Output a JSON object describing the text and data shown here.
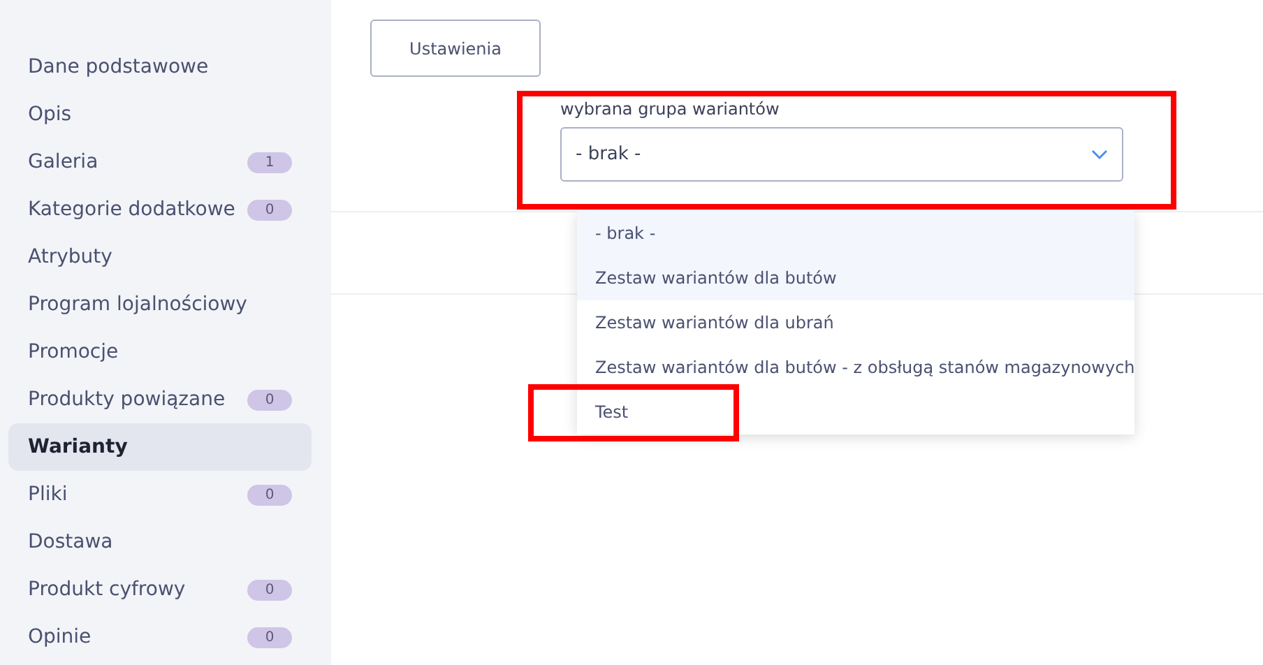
{
  "sidebar": {
    "items": [
      {
        "label": "Dane podstawowe",
        "selected": false
      },
      {
        "label": "Opis",
        "selected": false
      },
      {
        "label": "Galeria",
        "count": "1",
        "selected": false
      },
      {
        "label": "Kategorie dodatkowe",
        "count": "0",
        "selected": false
      },
      {
        "label": "Atrybuty",
        "selected": false
      },
      {
        "label": "Program lojalnościowy",
        "selected": false
      },
      {
        "label": "Promocje",
        "selected": false
      },
      {
        "label": "Produkty powiązane",
        "count": "0",
        "selected": false
      },
      {
        "label": "Warianty",
        "selected": true
      },
      {
        "label": "Pliki",
        "count": "0",
        "selected": false
      },
      {
        "label": "Dostawa",
        "selected": false
      },
      {
        "label": "Produkt cyfrowy",
        "count": "0",
        "selected": false
      },
      {
        "label": "Opinie",
        "count": "0",
        "selected": false
      }
    ]
  },
  "settings_button": "Ustawienia",
  "variant_group": {
    "label": "wybrana grupa wariantów",
    "value": "- brak -",
    "annotated": true,
    "expanded": true,
    "options": [
      {
        "label": "- brak -",
        "highlighted": true,
        "annotated": false
      },
      {
        "label": "Zestaw wariantów dla butów",
        "highlighted": true,
        "annotated": false
      },
      {
        "label": "Zestaw wariantów dla ubrań",
        "highlighted": false,
        "annotated": false
      },
      {
        "label": "Zestaw wariantów dla butów - z obsługą stanów magazynowych",
        "highlighted": false,
        "annotated": false
      },
      {
        "label": "Test",
        "highlighted": false,
        "annotated": true
      }
    ]
  }
}
